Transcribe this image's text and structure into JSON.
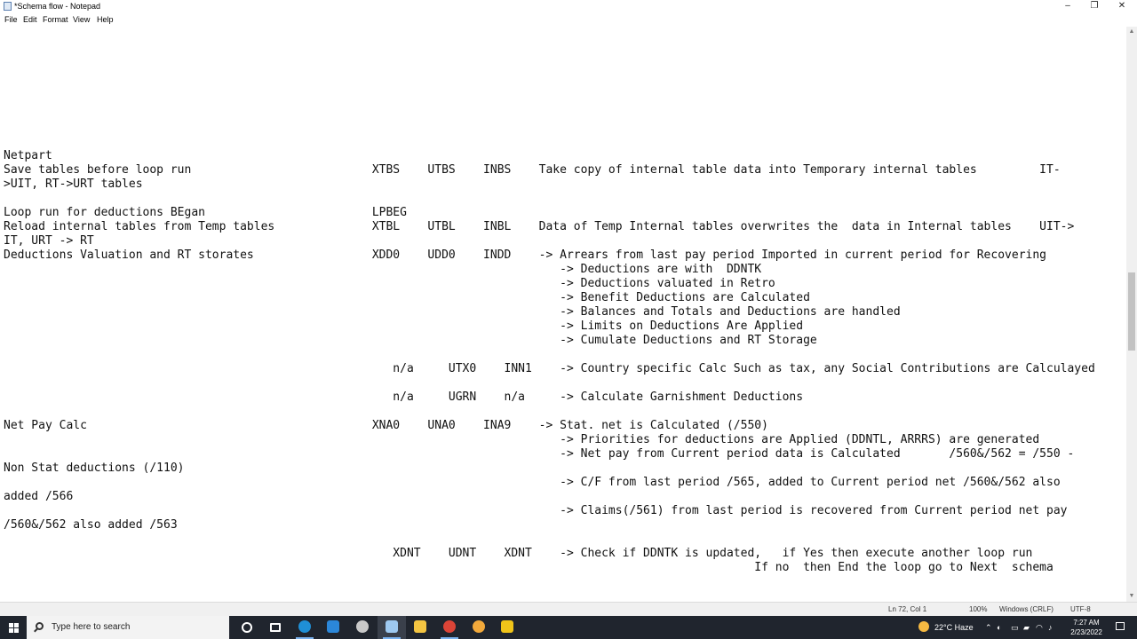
{
  "window": {
    "title": "*Schema flow - Notepad",
    "controls": {
      "minimize": "–",
      "maximize": "❐",
      "close": "✕"
    }
  },
  "menu": [
    "File",
    "Edit",
    "Format",
    "View",
    "Help"
  ],
  "editor": {
    "lines": [
      {
        "row": 9,
        "text": "Netpart"
      },
      {
        "row": 10,
        "text": "Save tables before loop run                          XTBS    UTBS    INBS    Take copy of internal table data into Temporary internal tables         IT-"
      },
      {
        "row": 11,
        "text": ">UIT, RT->URT tables"
      },
      {
        "row": 13,
        "text": "Loop run for deductions BEgan                        LPBEG"
      },
      {
        "row": 14,
        "text": "Reload internal tables from Temp tables              XTBL    UTBL    INBL    Data of Temp Internal tables overwrites the  data in Internal tables    UIT->"
      },
      {
        "row": 15,
        "text": "IT, URT -> RT"
      },
      {
        "row": 16,
        "text": "Deductions Valuation and RT storates                 XDD0    UDD0    INDD    -> Arrears from last pay period Imported in current period for Recovering"
      },
      {
        "row": 17,
        "text": "                                                                                -> Deductions are with  DDNTK"
      },
      {
        "row": 18,
        "text": "                                                                                -> Deductions valuated in Retro"
      },
      {
        "row": 19,
        "text": "                                                                                -> Benefit Deductions are Calculated"
      },
      {
        "row": 20,
        "text": "                                                                                -> Balances and Totals and Deductions are handled"
      },
      {
        "row": 21,
        "text": "                                                                                -> Limits on Deductions Are Applied"
      },
      {
        "row": 22,
        "text": "                                                                                -> Cumulate Deductions and RT Storage"
      },
      {
        "row": 24,
        "text": "                                                        n/a     UTX0    INN1    -> Country specific Calc Such as tax, any Social Contributions are Calculayed"
      },
      {
        "row": 26,
        "text": "                                                        n/a     UGRN    n/a     -> Calculate Garnishment Deductions"
      },
      {
        "row": 28,
        "text": "Net Pay Calc                                         XNA0    UNA0    INA9    -> Stat. net is Calculated (/550)"
      },
      {
        "row": 29,
        "text": "                                                                                -> Priorities for deductions are Applied (DDNTL, ARRRS) are generated"
      },
      {
        "row": 30,
        "text": "                                                                                -> Net pay from Current period data is Calculated       /560&/562 = /550 -"
      },
      {
        "row": 31,
        "text": "Non Stat deductions (/110)"
      },
      {
        "row": 32,
        "text": "                                                                                -> C/F from last period /565, added to Current period net /560&/562 also"
      },
      {
        "row": 33,
        "text": "added /566"
      },
      {
        "row": 34,
        "text": "                                                                                -> Claims(/561) from last period is recovered from Current period net pay"
      },
      {
        "row": 35,
        "text": "/560&/562 also added /563"
      },
      {
        "row": 37,
        "text": "                                                        XDNT    UDNT    XDNT    -> Check if DDNTK is updated,   if Yes then execute another loop run"
      },
      {
        "row": 38,
        "text": "                                                                                                            If no  then End the loop go to Next  schema"
      }
    ]
  },
  "status": {
    "position": "Ln 72, Col 1",
    "zoom": "100%",
    "line_ending": "Windows (CRLF)",
    "encoding": "UTF-8"
  },
  "taskbar": {
    "search_placeholder": "Type here to search",
    "apps": [
      {
        "name": "cortana-icon",
        "color": "#ffffff"
      },
      {
        "name": "task-view-icon",
        "color": "#ffffff"
      },
      {
        "name": "edge-icon",
        "color": "#1f8fd6"
      },
      {
        "name": "calculator-icon",
        "color": "#2b87d9"
      },
      {
        "name": "settings-app-icon",
        "color": "#c9c9c9"
      },
      {
        "name": "notepad-icon",
        "color": "#9ec9f0"
      },
      {
        "name": "file-explorer-icon",
        "color": "#f4c542"
      },
      {
        "name": "chrome-icon",
        "color": "#db4437"
      },
      {
        "name": "orange-app-icon",
        "color": "#f2a93b"
      },
      {
        "name": "yellow-app-icon",
        "color": "#f0c419"
      }
    ],
    "weather": "22°C  Haze",
    "time": "7:27 AM",
    "date": "2/23/2022"
  }
}
